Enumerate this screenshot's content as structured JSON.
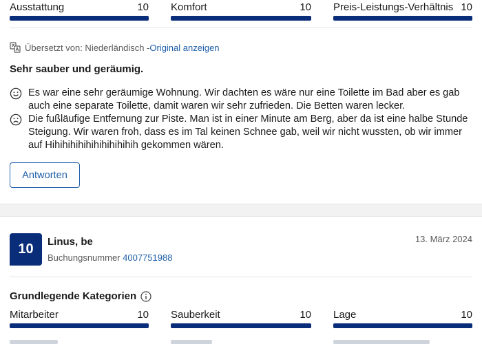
{
  "top_scores": [
    {
      "label": "Ausstattung",
      "value": "10",
      "fraction": 1.0
    },
    {
      "label": "Komfort",
      "value": "10",
      "fraction": 1.0
    },
    {
      "label": "Preis-Leistungs-Verhältnis",
      "value": "10",
      "fraction": 1.0
    }
  ],
  "review": {
    "translated_prefix": "Übersetzt von: Niederländisch - ",
    "show_original_link": "Original anzeigen",
    "title": "Sehr sauber und geräumig.",
    "positive_text": "Es war eine sehr geräumige Wohnung. Wir dachten es wäre nur eine Toilette im Bad aber es gab auch eine separate Toilette, damit waren wir sehr zufrieden. Die Betten waren lecker.",
    "negative_text": "Die fußläufige Entfernung zur Piste. Man ist in einer Minute am Berg, aber da ist eine halbe Stunde Steigung. Wir waren froh, dass es im Tal keinen Schnee gab, weil wir nicht wussten, ob wir immer auf Hihihihihihihihihihihih gekommen wären.",
    "reply_button": "Antworten",
    "icons": {
      "translate": "translate-icon",
      "positive": "smiley-happy-icon",
      "negative": "smiley-sad-icon"
    }
  },
  "next_review": {
    "score": "10",
    "reviewer": "Linus, be",
    "booking_label": "Buchungsnummer ",
    "booking_number": "4007751988",
    "date": "13. März 2024",
    "categories_title": "Grundlegende Kategorien",
    "categories_icon": "info-icon",
    "scores": [
      {
        "label": "Mitarbeiter",
        "value": "10",
        "fraction": 1.0
      },
      {
        "label": "Sauberkeit",
        "value": "10",
        "fraction": 1.0
      },
      {
        "label": "Lage",
        "value": "10",
        "fraction": 1.0
      }
    ]
  },
  "colors": {
    "brand": "#0a2d7a",
    "link": "#1f5fa8"
  }
}
